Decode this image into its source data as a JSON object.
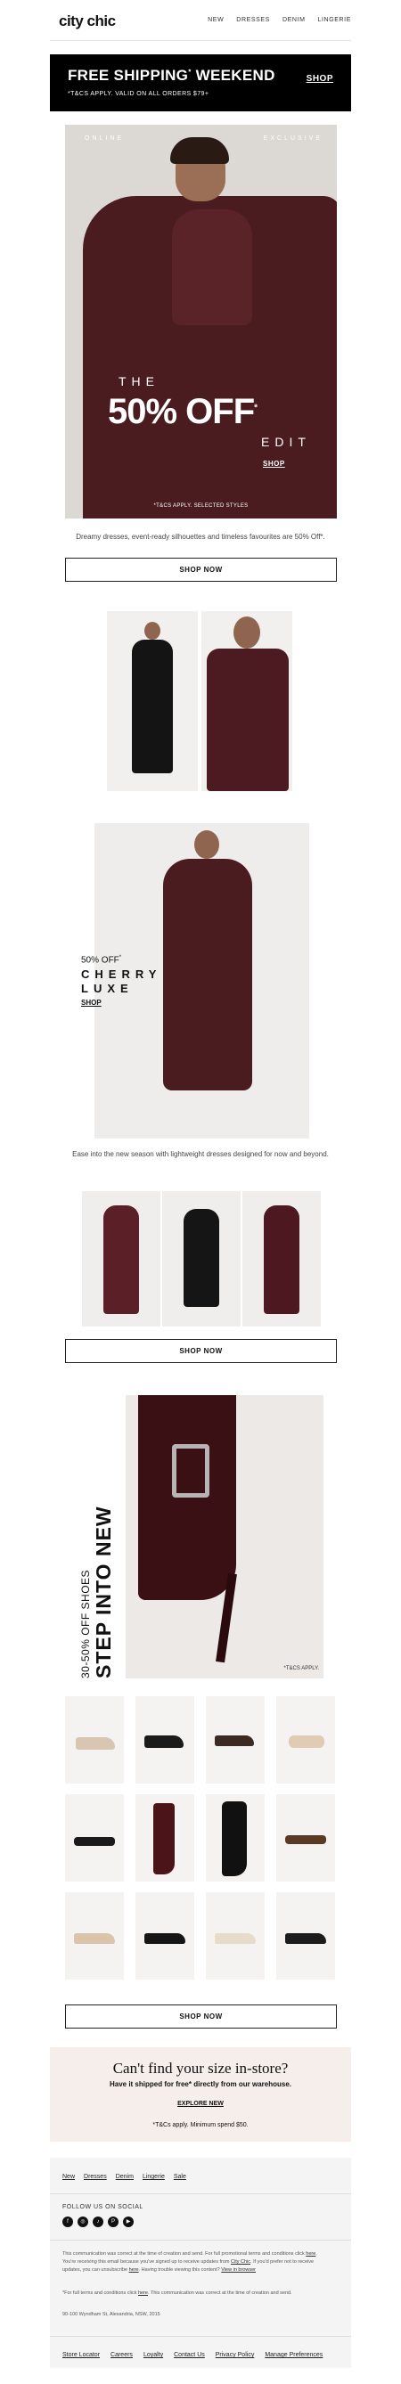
{
  "header": {
    "logo": "city chic",
    "nav": [
      "NEW",
      "DRESSES",
      "DENIM",
      "LINGERIE"
    ]
  },
  "shipping": {
    "title": "FREE SHIPPING",
    "title_sup": "*",
    "title_end": " WEEKEND",
    "subtitle": "*T&CS APPLY. VALID ON ALL ORDERS $79+",
    "link": "SHOP"
  },
  "hero": {
    "tag_left": "ONLINE",
    "tag_right": "EXCLUSIVE",
    "the": "THE",
    "big": "50% OFF",
    "big_sup": "*",
    "edit": "EDIT",
    "shop": "SHOP",
    "tc": "*T&CS APPLY. SELECTED STYLES",
    "copy": "Dreamy dresses, event-ready silhouettes and timeless favourites are 50% Off*.",
    "button": "SHOP NOW"
  },
  "cherry": {
    "off": "50% OFF",
    "off_sup": "*",
    "line1": "CHERRY",
    "line2": "LUXE",
    "shop": "SHOP",
    "copy": "Ease into the new season with lightweight dresses designed for now and beyond.",
    "button": "SHOP NOW"
  },
  "boots": {
    "sub": "30-50% OFF SHOES",
    "title": "STEP INTO NEW",
    "tc": "*T&CS APPLY.",
    "button": "SHOP NOW"
  },
  "size": {
    "title": "Can't find your size in-store?",
    "subtitle": "Have it shipped for free* directly from our warehouse.",
    "link": "EXPLORE NEW",
    "tc": "*T&Cs apply. Minimum spend $50."
  },
  "footer": {
    "nav": [
      "New",
      "Dresses",
      "Denim",
      "Lingerie",
      "Sale"
    ],
    "follow": "FOLLOW US ON SOCIAL",
    "socials": [
      "f",
      "◎",
      "♪",
      "P",
      "▶"
    ],
    "legal1a": "This communication was correct at the time of creation and send. For full promotional terms and conditions click ",
    "legal1b": "here",
    "legal1c": ". You're receiving this email because you've signed up to receive updates from ",
    "legal1d": "City Chic",
    "legal1e": ". If you'd prefer not to receive updates, you can unsubscribe ",
    "legal1f": "here",
    "legal1g": ". Having trouble viewing this content? ",
    "legal1h": "View in browser",
    "legal2a": "*For full terms and conditions click ",
    "legal2b": "here",
    "legal2c": ". This communication was correct at the time of creation and send.",
    "address": "90-100 Wyndham St, Alexandria, NSW, 2015",
    "links": [
      "Store Locator",
      "Careers",
      "Loyalty",
      "Contact Us",
      "Privacy Policy",
      "Manage Preferences"
    ]
  },
  "colors": {
    "brand_black": "#000000",
    "burgundy": "#4a1c20",
    "size_banner": "#f6eeea"
  }
}
